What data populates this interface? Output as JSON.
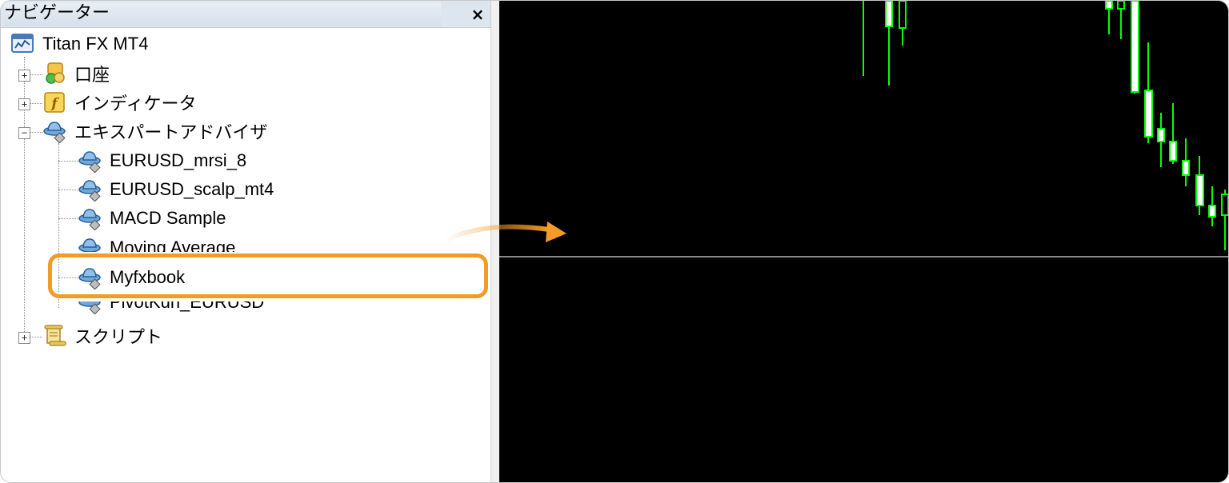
{
  "panel": {
    "title": "ナビゲーター",
    "close_label": "×"
  },
  "tree": {
    "root": "Titan FX MT4",
    "accounts": "口座",
    "indicators": "インディケータ",
    "experts": "エキスパートアドバイザ",
    "expert_items": [
      "EURUSD_mrsi_8",
      "EURUSD_scalp_mt4",
      "MACD Sample",
      "Moving Average",
      "Myfxbook",
      "PivotKun_EURUSD"
    ],
    "scripts": "スクリプト"
  },
  "colors": {
    "highlight": "#f29b28",
    "candle_wick": "#00ff00",
    "candle_body": "#ffffff",
    "chart_bg": "#000000"
  },
  "icons": {
    "root": "terminal-icon",
    "accounts": "accounts-icon",
    "indicators": "function-icon",
    "experts": "expert-hat-icon",
    "scripts": "scroll-icon"
  }
}
